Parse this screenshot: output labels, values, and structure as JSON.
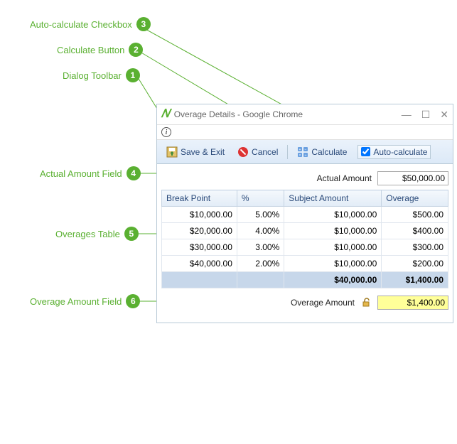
{
  "annotations": [
    {
      "n": "1",
      "label": "Dialog Toolbar"
    },
    {
      "n": "2",
      "label": "Calculate Button"
    },
    {
      "n": "3",
      "label": "Auto-calculate Checkbox"
    },
    {
      "n": "4",
      "label": "Actual Amount Field"
    },
    {
      "n": "5",
      "label": "Overages Table"
    },
    {
      "n": "6",
      "label": "Overage Amount Field"
    }
  ],
  "window": {
    "title": "Overage Details - Google Chrome",
    "controls": {
      "min": "—",
      "max": "☐",
      "close": "✕"
    }
  },
  "toolbar": {
    "save_exit": "Save & Exit",
    "cancel": "Cancel",
    "calculate": "Calculate",
    "autocalc_label": "Auto-calculate"
  },
  "fields": {
    "actual_amount_label": "Actual Amount",
    "actual_amount_value": "$50,000.00",
    "overage_amount_label": "Overage Amount",
    "overage_amount_value": "$1,400.00"
  },
  "table": {
    "headers": {
      "bp": "Break Point",
      "pct": "%",
      "subj": "Subject Amount",
      "ov": "Overage"
    },
    "rows": [
      {
        "bp": "$10,000.00",
        "pct": "5.00%",
        "subj": "$10,000.00",
        "ov": "$500.00"
      },
      {
        "bp": "$20,000.00",
        "pct": "4.00%",
        "subj": "$10,000.00",
        "ov": "$400.00"
      },
      {
        "bp": "$30,000.00",
        "pct": "3.00%",
        "subj": "$10,000.00",
        "ov": "$300.00"
      },
      {
        "bp": "$40,000.00",
        "pct": "2.00%",
        "subj": "$10,000.00",
        "ov": "$200.00"
      }
    ],
    "total": {
      "subj": "$40,000.00",
      "ov": "$1,400.00"
    }
  }
}
